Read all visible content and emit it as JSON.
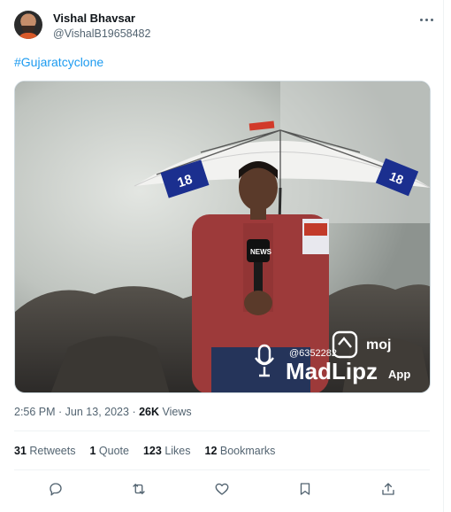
{
  "user": {
    "name": "Vishal Bhavsar",
    "handle": "@VishalB19658482"
  },
  "tweet": {
    "hashtag": "#Gujaratcyclone",
    "time": "2:56 PM",
    "date": "Jun 13, 2023",
    "sep1": " · ",
    "sep2": " · ",
    "views_count": "26K",
    "views_label": " Views"
  },
  "media": {
    "watermark_handle": "@6352282",
    "watermark_brand": "MadLipz",
    "watermark_app": "App",
    "watermark_moj": "moj",
    "umbrella_text_left": "18",
    "umbrella_text_right": "18",
    "mic_label": "NEWS"
  },
  "stats": {
    "retweets_count": "31",
    "retweets_label": " Retweets",
    "quotes_count": "1",
    "quotes_label": " Quote",
    "likes_count": "123",
    "likes_label": " Likes",
    "bookmarks_count": "12",
    "bookmarks_label": " Bookmarks"
  },
  "icons": {
    "reply": "reply-icon",
    "retweet": "retweet-icon",
    "like": "heart-icon",
    "bookmark": "bookmark-icon",
    "share": "share-icon",
    "more": "more-icon"
  },
  "colors": {
    "accent": "#1d9bf0",
    "text": "#0f1419",
    "secondary": "#536471"
  }
}
